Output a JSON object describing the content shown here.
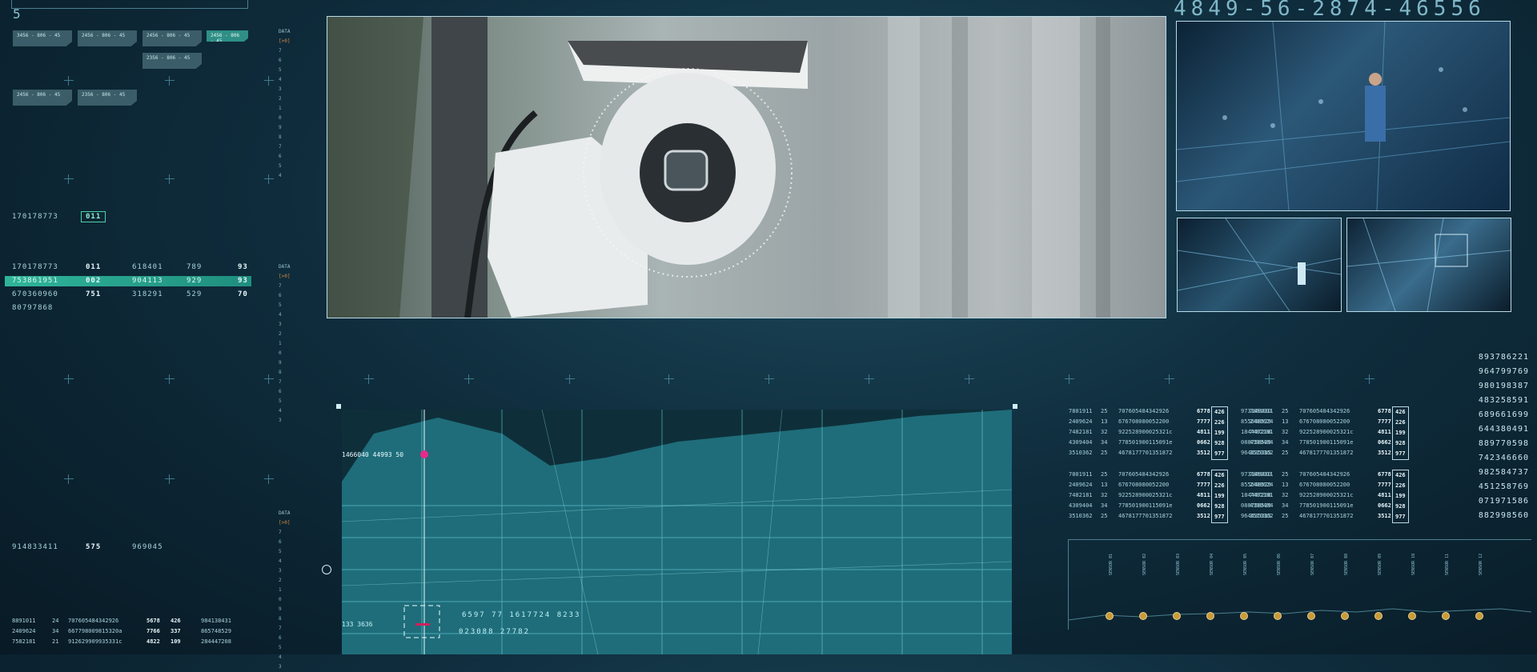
{
  "top_left_number": "5",
  "tiles": [
    {
      "label": "3456 - 806 - 45"
    },
    {
      "label": "2456 - 806 - 45"
    },
    {
      "label": "2456 - 806 - 45"
    },
    {
      "label": "2456 - 806 - 45",
      "highlight": true
    },
    {
      "label": "2356 - 806 - 45"
    },
    {
      "label": "2456 - 806 - 45"
    },
    {
      "label": "2356 - 806 - 45"
    }
  ],
  "id_line": {
    "number": "170178773",
    "tag": "011"
  },
  "data_rows": [
    {
      "a": "170178773",
      "b": "011",
      "c": "618401",
      "d": "789",
      "e": "93",
      "selected": false
    },
    {
      "a": "753861951",
      "b": "002",
      "c": "904113",
      "d": "929",
      "e": "93",
      "selected": true
    },
    {
      "a": "670360960",
      "b": "751",
      "c": "318291",
      "d": "529",
      "e": "70",
      "selected": false
    },
    {
      "a": "80797868",
      "b": "",
      "c": "",
      "d": "",
      "e": "",
      "selected": false
    }
  ],
  "lower_left_row": {
    "a": "914833411",
    "b": "575",
    "c": "969045"
  },
  "bottom_left_table": [
    {
      "a": "8891011",
      "b": "24",
      "c": "707605484342926",
      "d": "5678",
      "e": "426",
      "f": "984138431"
    },
    {
      "a": "2409624",
      "b": "34",
      "c": "667798009815320a",
      "d": "7766",
      "e": "337",
      "f": "865748529"
    },
    {
      "a": "7582181",
      "b": "21",
      "c": "912629909935331c",
      "d": "4822",
      "e": "109",
      "f": "284447208"
    }
  ],
  "data_column_header": "DATA",
  "data_column_tag": "[>0]",
  "data_column_values": [
    "7",
    "6",
    "5",
    "4",
    "3",
    "2",
    "1",
    "0",
    "9",
    "8",
    "7",
    "6",
    "5",
    "4",
    "3",
    "2",
    "1",
    "0",
    "9",
    "8",
    "7",
    "6",
    "5",
    "4",
    "3",
    "2",
    "1",
    "0",
    "9",
    "8",
    "7",
    "6",
    "5",
    "4",
    "3",
    "2",
    "1"
  ],
  "big_id": "4849-56-2874-46556",
  "map_overlay": {
    "coords_top": "1466040  44993  50",
    "coords_bottom_1": "6597  77  1617724  8233",
    "coords_bottom_2": "023088  27782",
    "coords_left": "133  3636"
  },
  "right_numbers": [
    "893786221",
    "964799769",
    "980198387",
    "483258591",
    "689661699",
    "644380491",
    "889770598",
    "742346660",
    "982584737",
    "451258769",
    "071971586",
    "882998560"
  ],
  "right_table_block": {
    "col_a": [
      "7801911",
      "2409624",
      "7482181",
      "4309404",
      "3510362"
    ],
    "col_b": [
      "25",
      "13",
      "32",
      "34",
      "25"
    ],
    "col_c": [
      "707605484342926",
      "676708080052200",
      "922528900025321c",
      "778501900115091e",
      "4678177701351872"
    ],
    "col_d": [
      "6778",
      "7777",
      "4811",
      "0662",
      "3512"
    ],
    "col_e": [
      "426",
      "226",
      "199",
      "928",
      "977"
    ],
    "col_f": [
      "973149430",
      "855648529",
      "184447208",
      "088758539",
      "964635315"
    ]
  },
  "timeline_labels": [
    "SENSOR 01",
    "SENSOR 02",
    "SENSOR 03",
    "SENSOR 04",
    "SENSOR 05",
    "SENSOR 06",
    "SENSOR 07",
    "SENSOR 08",
    "SENSOR 09",
    "SENSOR 10",
    "SENSOR 11",
    "SENSOR 12"
  ]
}
